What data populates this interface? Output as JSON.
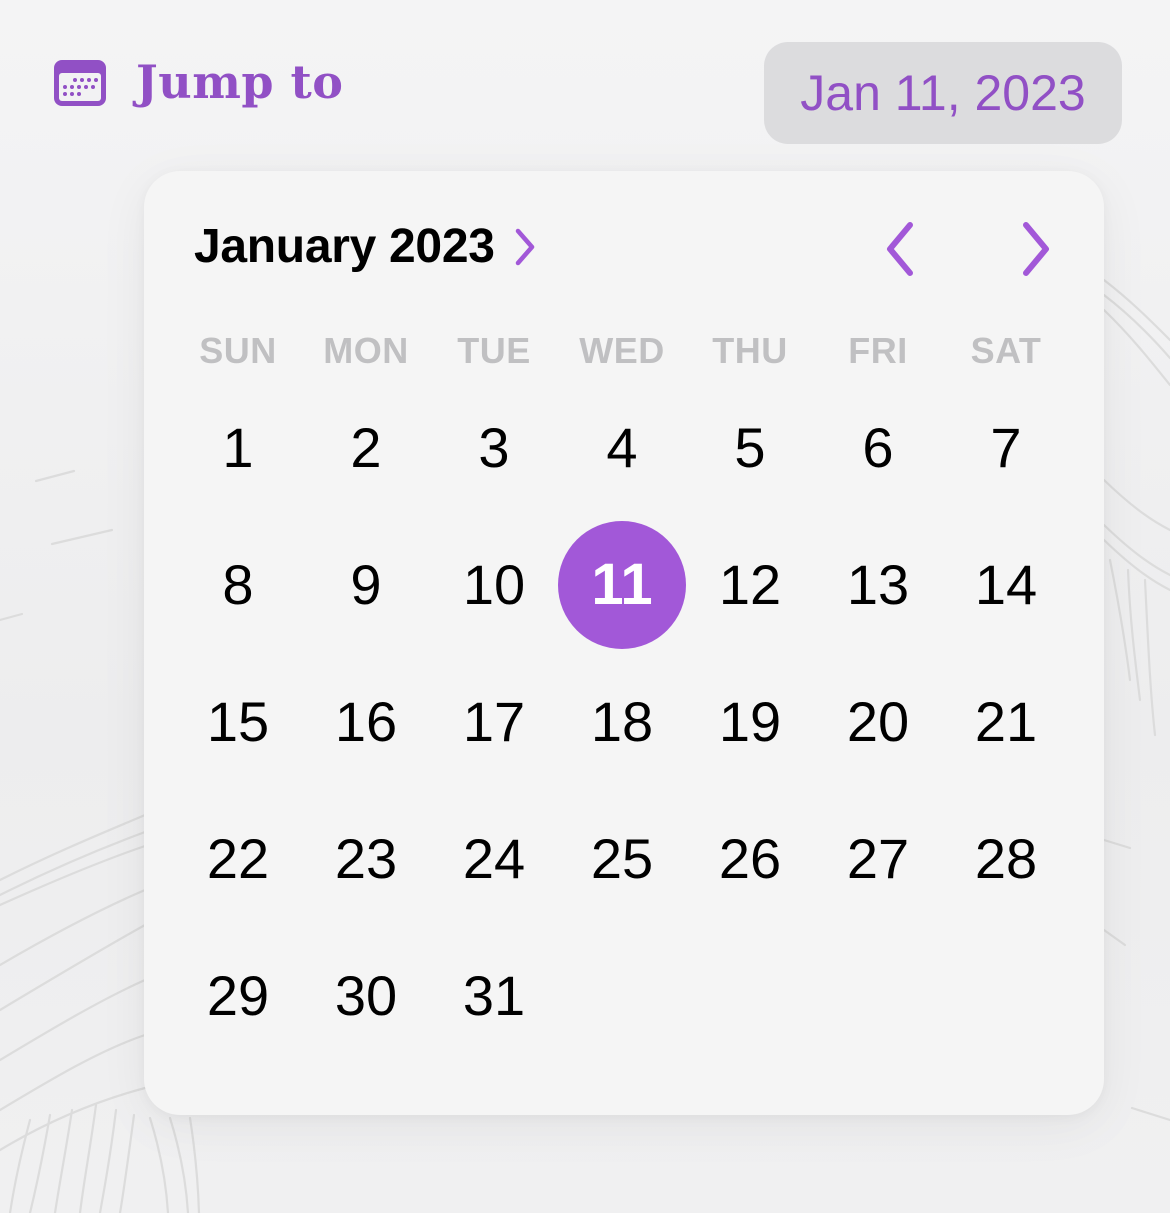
{
  "header": {
    "jump_label": "Jump to",
    "selected_date_label": "Jan 11, 2023",
    "icon": "calendar-icon"
  },
  "calendar": {
    "month_title": "January 2023",
    "month_chevron_icon": "chevron-right-icon",
    "prev_icon": "chevron-left-icon",
    "next_icon": "chevron-right-icon",
    "weekdays": [
      "SUN",
      "MON",
      "TUE",
      "WED",
      "THU",
      "FRI",
      "SAT"
    ],
    "first_weekday_offset": 0,
    "days": [
      "1",
      "2",
      "3",
      "4",
      "5",
      "6",
      "7",
      "8",
      "9",
      "10",
      "11",
      "12",
      "13",
      "14",
      "15",
      "16",
      "17",
      "18",
      "19",
      "20",
      "21",
      "22",
      "23",
      "24",
      "25",
      "26",
      "27",
      "28",
      "29",
      "30",
      "31"
    ],
    "selected_day": "11"
  },
  "colors": {
    "accent": "#a258d8",
    "accent_text": "#9150c5",
    "weekday_text": "#c0c0c2",
    "day_text": "#000000",
    "popover_bg": "#f5f5f5",
    "pill_bg": "#dcdcde"
  }
}
